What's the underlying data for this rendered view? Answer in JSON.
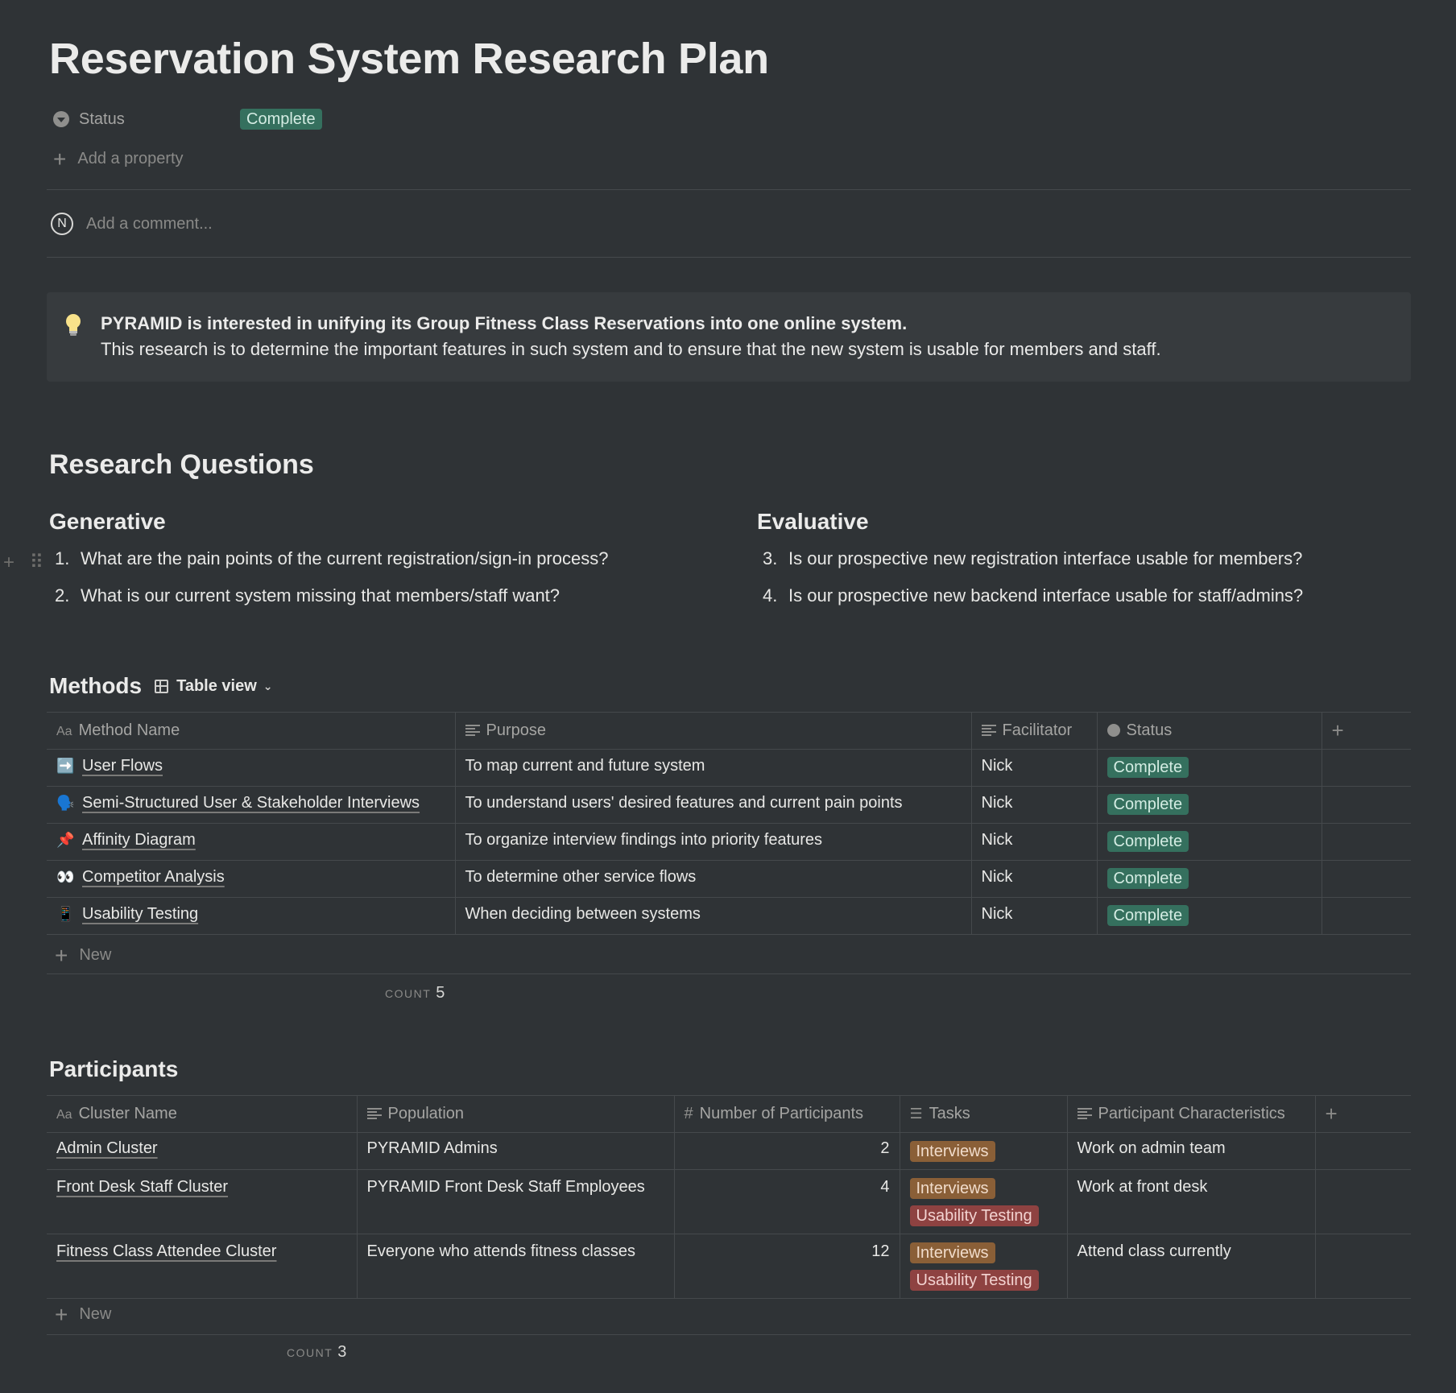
{
  "page": {
    "title": "Reservation System Research Plan",
    "status_label": "Status",
    "status_value": "Complete",
    "add_property": "Add a property",
    "avatar_initial": "N",
    "comment_placeholder": "Add a comment..."
  },
  "callout": {
    "line1": "PYRAMID is interested in unifying its Group Fitness Class Reservations into one online system.",
    "line2": "This research is to determine the important features in such system and to ensure that the new system is usable for members and staff."
  },
  "research": {
    "heading": "Research Questions",
    "generative": {
      "heading": "Generative",
      "items": [
        {
          "num": "1.",
          "text": "What are the pain points of the current registration/sign-in process?"
        },
        {
          "num": "2.",
          "text": "What is our current system missing that members/staff want?"
        }
      ]
    },
    "evaluative": {
      "heading": "Evaluative",
      "items": [
        {
          "num": "3.",
          "text": "Is our prospective new registration interface usable for members?"
        },
        {
          "num": "4.",
          "text": "Is our prospective new backend interface usable for staff/admins?"
        }
      ]
    }
  },
  "methods": {
    "title": "Methods",
    "view_label": "Table view",
    "columns": [
      "Method Name",
      "Purpose",
      "Facilitator",
      "Status"
    ],
    "rows": [
      {
        "icon": "➡️",
        "name": "User Flows",
        "purpose": "To map current and future system",
        "facilitator": "Nick",
        "status": "Complete"
      },
      {
        "icon": "🗣️",
        "name": "Semi-Structured User & Stakeholder Interviews",
        "purpose": "To understand users' desired features and current pain points",
        "facilitator": "Nick",
        "status": "Complete"
      },
      {
        "icon": "📌",
        "name": "Affinity Diagram",
        "purpose": "To organize interview findings into priority features",
        "facilitator": "Nick",
        "status": "Complete"
      },
      {
        "icon": "👀",
        "name": "Competitor Analysis",
        "purpose": "To determine other service flows",
        "facilitator": "Nick",
        "status": "Complete"
      },
      {
        "icon": "📱",
        "name": "Usability Testing",
        "purpose": "When deciding between systems",
        "facilitator": "Nick",
        "status": "Complete"
      }
    ],
    "new_label": "New",
    "count_label": "COUNT",
    "count_value": "5"
  },
  "participants": {
    "title": "Participants",
    "columns": [
      "Cluster Name",
      "Population",
      "Number of Participants",
      "Tasks",
      "Participant Characteristics"
    ],
    "rows": [
      {
        "name": "Admin Cluster",
        "population": "PYRAMID Admins",
        "number": "2",
        "tasks": [
          "Interviews"
        ],
        "characteristics": "Work on admin team"
      },
      {
        "name": "Front Desk Staff Cluster",
        "population": "PYRAMID Front Desk Staff Employees",
        "number": "4",
        "tasks": [
          "Interviews",
          "Usability Testing"
        ],
        "characteristics": "Work at front desk"
      },
      {
        "name": "Fitness Class Attendee Cluster",
        "population": "Everyone who attends fitness classes",
        "number": "12",
        "tasks": [
          "Interviews",
          "Usability Testing"
        ],
        "characteristics": "Attend class currently"
      }
    ],
    "new_label": "New",
    "count_label": "COUNT",
    "count_value": "3"
  },
  "colors": {
    "background": "#2f3336",
    "tag_green": "#35705e",
    "tag_orange": "#8a5f37",
    "tag_red": "#8e4241"
  }
}
